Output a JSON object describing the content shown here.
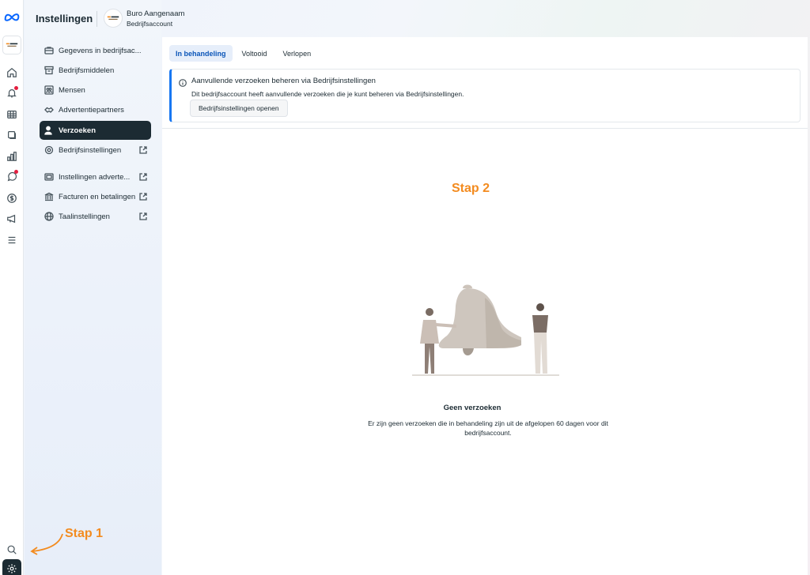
{
  "rail": {
    "logo_icon": "meta-logo-icon",
    "biz_logo_icon": "business-logo-icon",
    "items": [
      {
        "icon": "home-icon"
      },
      {
        "icon": "bell-icon",
        "badge": true
      },
      {
        "icon": "table-icon"
      },
      {
        "icon": "pages-icon"
      },
      {
        "icon": "chart-icon"
      },
      {
        "icon": "chat-icon",
        "badge": true
      },
      {
        "icon": "dollar-icon"
      },
      {
        "icon": "megaphone-icon"
      },
      {
        "icon": "menu-icon"
      }
    ],
    "search_icon": "search-icon",
    "settings_icon": "gear-icon"
  },
  "header": {
    "title": "Instellingen",
    "business_name": "Buro Aangenaam",
    "business_type": "Bedrijfsaccount"
  },
  "sidebar": {
    "items": [
      {
        "label": "Gegevens in bedrijfsac...",
        "icon": "briefcase-icon",
        "external": false,
        "active": false
      },
      {
        "label": "Bedrijfsmiddelen",
        "icon": "archive-icon",
        "external": false,
        "active": false
      },
      {
        "label": "Mensen",
        "icon": "people-icon",
        "external": false,
        "active": false
      },
      {
        "label": "Advertentiepartners",
        "icon": "handshake-icon",
        "external": false,
        "active": false
      },
      {
        "label": "Verzoeken",
        "icon": "person-add-icon",
        "external": false,
        "active": true
      },
      {
        "label": "Bedrijfsinstellingen",
        "icon": "gear-icon",
        "external": true,
        "active": false
      },
      {
        "label": "Instellingen adverte...",
        "icon": "ad-settings-icon",
        "external": true,
        "active": false
      },
      {
        "label": "Facturen en betalingen",
        "icon": "bank-icon",
        "external": true,
        "active": false
      },
      {
        "label": "Taalinstellingen",
        "icon": "globe-icon",
        "external": true,
        "active": false
      }
    ]
  },
  "tabs": [
    {
      "label": "In behandeling",
      "active": true
    },
    {
      "label": "Voltooid",
      "active": false
    },
    {
      "label": "Verlopen",
      "active": false
    }
  ],
  "info": {
    "title": "Aanvullende verzoeken beheren via Bedrijfsinstellingen",
    "description": "Dit bedrijfsaccount heeft aanvullende verzoeken die je kunt beheren via Bedrijfsinstellingen.",
    "button": "Bedrijfsinstellingen openen"
  },
  "empty": {
    "title": "Geen verzoeken",
    "description": "Er zijn geen verzoeken die in behandeling zijn uit de afgelopen 60 dagen voor dit bedrijfsaccount."
  },
  "annotations": {
    "step1": "Stap 1",
    "step2": "Stap 2",
    "color": "#f38b1f"
  },
  "colors": {
    "active_nav": "#1c2b33",
    "accent": "#1877f2",
    "active_tab_text": "#0a55b8"
  }
}
